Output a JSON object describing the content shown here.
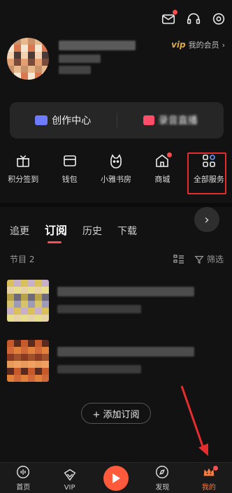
{
  "header": {
    "icons": [
      "mail-icon",
      "headset-icon",
      "settings-icon"
    ],
    "vip_mark": "vip",
    "vip_label": "我的会员",
    "vip_chevron": "›"
  },
  "creator": {
    "left_label": "创作中心",
    "right_label": "录音直播"
  },
  "quick": [
    {
      "label": "积分签到",
      "icon": "gift-icon"
    },
    {
      "label": "钱包",
      "icon": "wallet-icon"
    },
    {
      "label": "小雅书房",
      "icon": "cat-icon"
    },
    {
      "label": "商城",
      "icon": "shop-icon"
    },
    {
      "label": "全部服务",
      "icon": "grid-icon"
    }
  ],
  "tabs": [
    "追更",
    "订阅",
    "历史",
    "下载"
  ],
  "tab_more": "›",
  "list": {
    "count_label": "节目 2",
    "filter_label": "筛选"
  },
  "add_button": "+ 添加订阅",
  "nav": [
    {
      "label": "首页",
      "icon": "home-icon"
    },
    {
      "label": "VIP",
      "icon": "vip-icon"
    },
    {
      "label": "",
      "icon": "play-icon"
    },
    {
      "label": "发现",
      "icon": "discover-icon"
    },
    {
      "label": "我的",
      "icon": "me-icon"
    }
  ],
  "colors": {
    "accent": "#ff4d4f",
    "play": "#ff5a3c",
    "active_nav": "#ff7a3d",
    "highlight": "#e62d2d"
  }
}
